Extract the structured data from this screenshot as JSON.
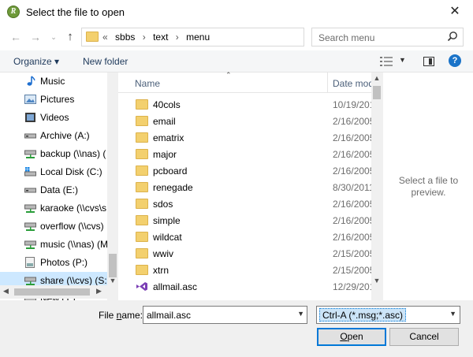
{
  "window": {
    "title": "Select the file to open",
    "app_icon_letter": "R"
  },
  "address": {
    "overflow": "«",
    "crumbs": [
      "sbbs",
      "text",
      "menu"
    ],
    "separator": "›"
  },
  "search": {
    "placeholder": "Search menu"
  },
  "toolbar": {
    "organize": "Organize ▾",
    "new_folder": "New folder"
  },
  "nav_pane": {
    "items": [
      {
        "label": "Music",
        "icon": "music-icon"
      },
      {
        "label": "Pictures",
        "icon": "pictures-icon"
      },
      {
        "label": "Videos",
        "icon": "videos-icon"
      },
      {
        "label": "Archive (A:)",
        "icon": "drive-icon"
      },
      {
        "label": "backup (\\\\nas) (",
        "icon": "network-drive-icon"
      },
      {
        "label": "Local Disk (C:)",
        "icon": "windows-drive-icon"
      },
      {
        "label": "Data (E:)",
        "icon": "drive-icon"
      },
      {
        "label": "karaoke (\\\\cvs\\s",
        "icon": "network-drive-icon"
      },
      {
        "label": "overflow (\\\\cvs)",
        "icon": "network-drive-icon"
      },
      {
        "label": "music (\\\\nas) (M",
        "icon": "network-drive-icon"
      },
      {
        "label": "Photos (P:)",
        "icon": "drive-icon"
      },
      {
        "label": "share (\\\\cvs) (S:)",
        "icon": "network-drive-icon",
        "selected": true
      },
      {
        "label": "New (T:)",
        "icon": "drive-icon"
      }
    ]
  },
  "file_list": {
    "columns": {
      "name": "Name",
      "date": "Date mod"
    },
    "files": [
      {
        "name": "40cols",
        "date": "10/19/201",
        "type": "folder"
      },
      {
        "name": "email",
        "date": "2/16/2005",
        "type": "folder"
      },
      {
        "name": "ematrix",
        "date": "2/16/2005",
        "type": "folder"
      },
      {
        "name": "major",
        "date": "2/16/2005",
        "type": "folder"
      },
      {
        "name": "pcboard",
        "date": "2/16/2005",
        "type": "folder"
      },
      {
        "name": "renegade",
        "date": "8/30/2011",
        "type": "folder"
      },
      {
        "name": "sdos",
        "date": "2/16/2005",
        "type": "folder"
      },
      {
        "name": "simple",
        "date": "2/16/2005",
        "type": "folder"
      },
      {
        "name": "wildcat",
        "date": "2/16/2005",
        "type": "folder"
      },
      {
        "name": "wwiv",
        "date": "2/15/2005",
        "type": "folder"
      },
      {
        "name": "xtrn",
        "date": "2/15/2005",
        "type": "folder"
      },
      {
        "name": "allmail.asc",
        "date": "12/29/201",
        "type": "file"
      }
    ]
  },
  "preview": {
    "text": "Select a file to preview."
  },
  "bottom": {
    "file_name_label_pre": "File ",
    "file_name_label_u": "n",
    "file_name_label_post": "ame:",
    "file_name_value": "allmail.asc",
    "filter_value": "Ctrl-A (*.msg;*.asc)",
    "open_u": "O",
    "open_rest": "pen",
    "cancel": "Cancel"
  },
  "colors": {
    "accent": "#0078d7",
    "selected_nav": "#cde8ff",
    "folder": "#f3d06e"
  }
}
